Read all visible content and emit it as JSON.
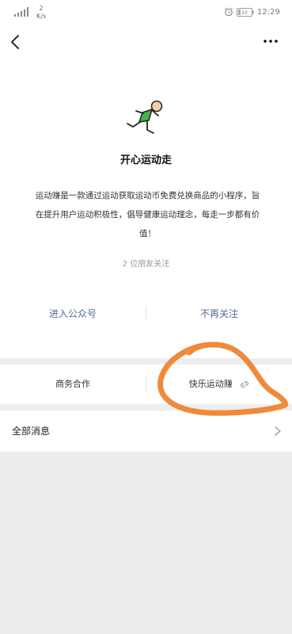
{
  "status_bar": {
    "network_speed_value": "2",
    "network_speed_unit": "K/s",
    "battery_text": "10",
    "time": "12:29"
  },
  "profile": {
    "name": "开心运动走",
    "description": "运动赚是一款通过运动获取运动币免费兑换商品的小程序，旨在提升用户运动积极性，倡导健康运动理念，每走一步都有价值！",
    "followers": "2 位朋友关注"
  },
  "actions": {
    "enter_account": "进入公众号",
    "unfollow": "不再关注"
  },
  "menu": {
    "business": "商务合作",
    "mini_program": "快乐运动赚"
  },
  "all_messages": {
    "label": "全部消息"
  },
  "colors": {
    "link_blue": "#576b95",
    "annotation_orange": "#f08a3a",
    "logo_green": "#3cb54a"
  },
  "icons": {
    "back": "chevron-left-icon",
    "more": "more-dots-icon",
    "mini_program": "mini-program-icon",
    "chevron": "chevron-right-icon"
  }
}
